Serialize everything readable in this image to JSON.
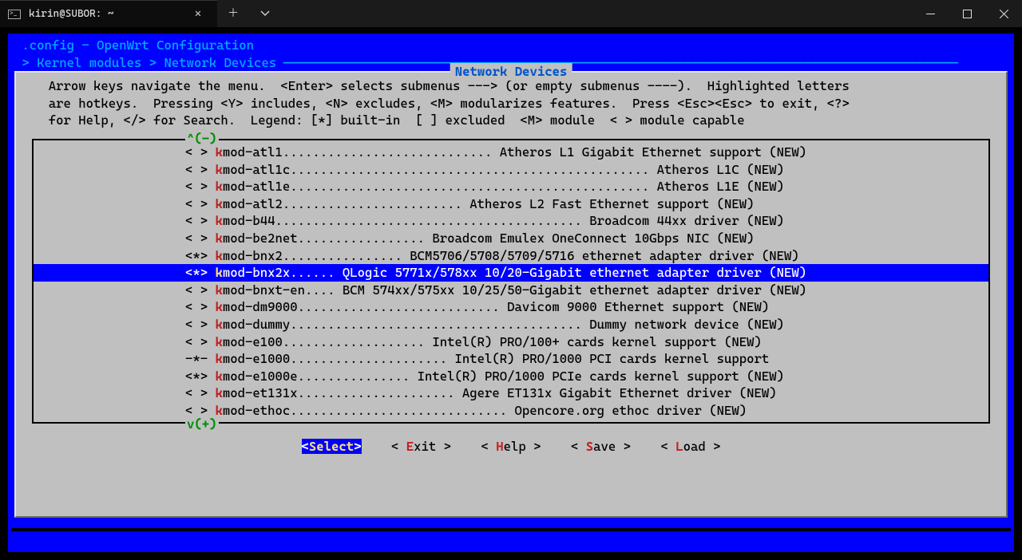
{
  "window": {
    "tab_title": "kirin@SUBOR: ~"
  },
  "header": {
    "line1": " .config - OpenWrt Configuration",
    "line2_prefix": " > Kernel modules > Network Devices ",
    "dialog_title": " Network Devices "
  },
  "help": "  Arrow keys navigate the menu.  <Enter> selects submenus ---> (or empty submenus ----).  Highlighted letters\n  are hotkeys.  Pressing <Y> includes, <N> excludes, <M> modularizes features.  Press <Esc><Esc> to exit, <?>\n  for Help, </> for Search.  Legend: [*] built-in  [ ] excluded  <M> module  < > module capable",
  "scroll": {
    "up": "^(-)",
    "down": "v(+)"
  },
  "items": [
    {
      "mark": "< >",
      "hk": "k",
      "name": "mod-atl1",
      "dots": "............................ ",
      "desc": "Atheros L1 Gigabit Ethernet support (NEW)",
      "sel": false
    },
    {
      "mark": "< >",
      "hk": "k",
      "name": "mod-atl1c",
      "dots": "................................................ ",
      "desc": "Atheros L1C (NEW)",
      "sel": false
    },
    {
      "mark": "< >",
      "hk": "k",
      "name": "mod-atl1e",
      "dots": "................................................ ",
      "desc": "Atheros L1E (NEW)",
      "sel": false
    },
    {
      "mark": "< >",
      "hk": "k",
      "name": "mod-atl2",
      "dots": "........................ ",
      "desc": "Atheros L2 Fast Ethernet support (NEW)",
      "sel": false
    },
    {
      "mark": "< >",
      "hk": "k",
      "name": "mod-b44",
      "dots": "......................................... ",
      "desc": "Broadcom 44xx driver (NEW)",
      "sel": false
    },
    {
      "mark": "< >",
      "hk": "k",
      "name": "mod-be2net",
      "dots": "................. ",
      "desc": "Broadcom Emulex OneConnect 10Gbps NIC (NEW)",
      "sel": false
    },
    {
      "mark": "<*>",
      "hk": "k",
      "name": "mod-bnx2",
      "dots": "................ ",
      "desc": "BCM5706/5708/5709/5716 ethernet adapter driver (NEW)",
      "sel": false
    },
    {
      "mark": "<*>",
      "hk": "k",
      "name": "mod-bnx2x",
      "dots": "...... ",
      "desc": "QLogic 5771x/578xx 10/20-Gigabit ethernet adapter driver (NEW)",
      "sel": true
    },
    {
      "mark": "< >",
      "hk": "k",
      "name": "mod-bnxt-en",
      "dots": ".... ",
      "desc": "BCM 574xx/575xx 10/25/50-Gigabit ethernet adapter driver (NEW)",
      "sel": false
    },
    {
      "mark": "< >",
      "hk": "k",
      "name": "mod-dm9000",
      "dots": "........................... ",
      "desc": "Davicom 9000 Ethernet support (NEW)",
      "sel": false
    },
    {
      "mark": "< >",
      "hk": "k",
      "name": "mod-dummy",
      "dots": "....................................... ",
      "desc": "Dummy network device (NEW)",
      "sel": false
    },
    {
      "mark": "< >",
      "hk": "k",
      "name": "mod-e100",
      "dots": "................... ",
      "desc": "Intel(R) PRO/100+ cards kernel support (NEW)",
      "sel": false
    },
    {
      "mark": "-*-",
      "hk": "k",
      "name": "mod-e1000",
      "dots": "..................... ",
      "desc": "Intel(R) PRO/1000 PCI cards kernel support",
      "sel": false
    },
    {
      "mark": "<*>",
      "hk": "k",
      "name": "mod-e1000e",
      "dots": "............... ",
      "desc": "Intel(R) PRO/1000 PCIe cards kernel support (NEW)",
      "sel": false
    },
    {
      "mark": "< >",
      "hk": "k",
      "name": "mod-et131x",
      "dots": "..................... ",
      "desc": "Agere ET131x Gigabit Ethernet driver (NEW)",
      "sel": false
    },
    {
      "mark": "< >",
      "hk": "k",
      "name": "mod-ethoc",
      "dots": "............................. ",
      "desc": "Opencore.org ethoc driver (NEW)",
      "sel": false
    }
  ],
  "footer": {
    "select": "Select",
    "exit": "xit ",
    "help": "elp ",
    "save": "ave ",
    "load": "oad ",
    "eh": "E",
    "hh": "H",
    "sh": "S",
    "lh": "L"
  }
}
